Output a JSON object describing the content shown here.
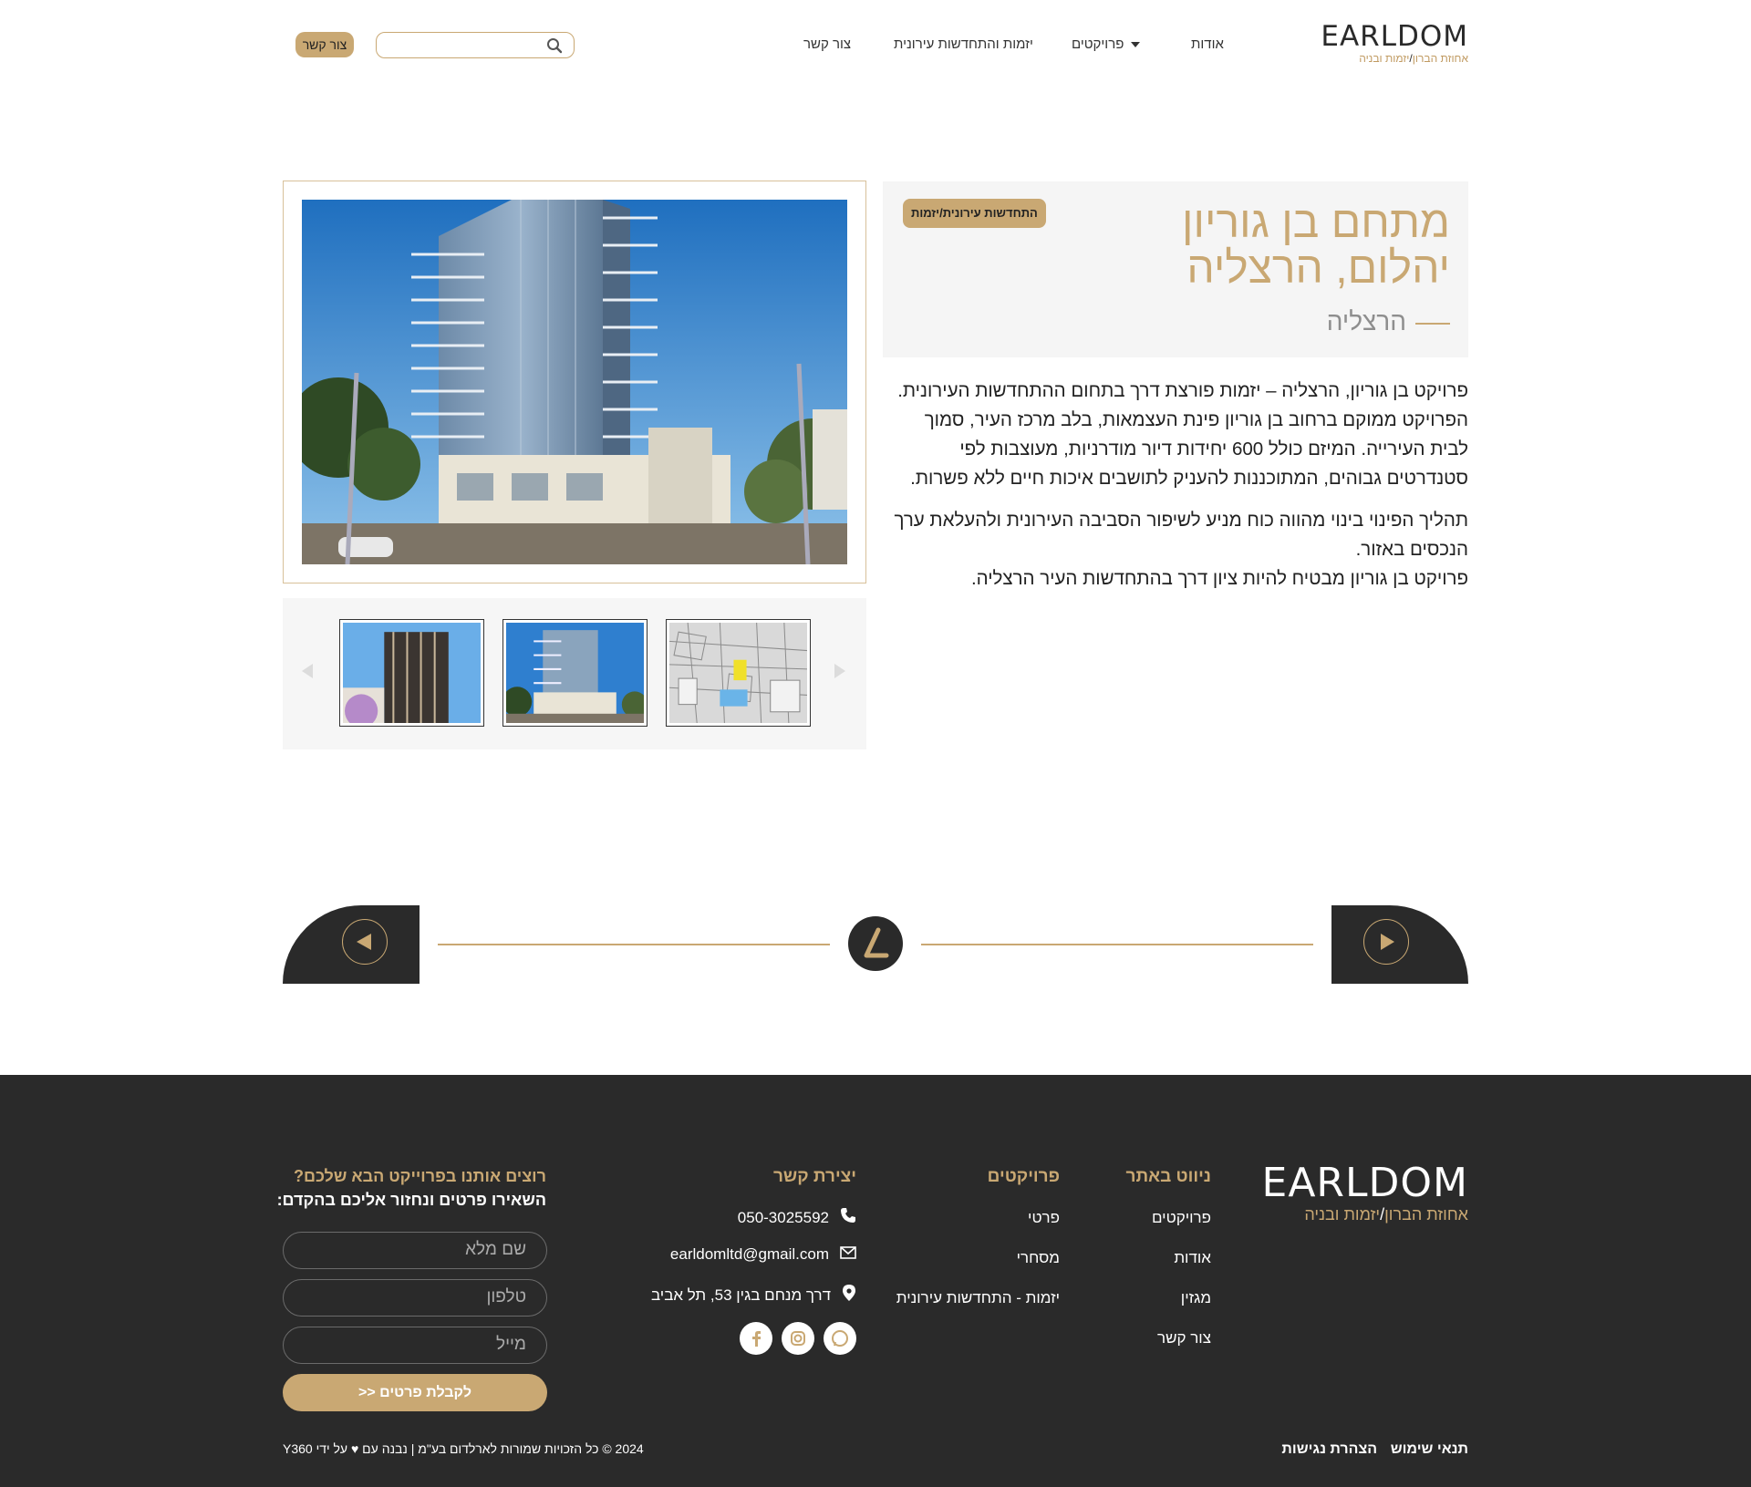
{
  "header": {
    "logo_word": "EARLDOM",
    "logo_sub_1": "אחוזת הברון",
    "logo_sub_sep": "/",
    "logo_sub_2": "יזמות ובניה",
    "nav": [
      "אודות",
      "פרויקטים",
      "יזמות והתחדשות עירונית",
      "צור קשר"
    ],
    "search_placeholder": "",
    "contact_button": "צור קשר"
  },
  "project": {
    "title": "מתחם בן גוריון יהלום, הרצליה",
    "city": "הרצליה",
    "category": "התחדשות עירונית/יזמות",
    "paragraphs": [
      "פרויקט בן גוריון, הרצליה – יזמות פורצת דרך בתחום ההתחדשות העירונית. הפרויקט ממוקם ברחוב בן גוריון פינת העצמאות, בלב מרכז העיר, סמוך לבית העירייה. המיזם כולל 600 יחידות דיור מודרניות, מעוצבות לפי סטנדרטים גבוהים, המתוכננות להעניק לתושבים איכות חיים ללא פשרות.",
      "תהליך הפינוי בינוי מהווה כוח מניע לשיפור הסביבה העירונית ולהעלאת ערך הנכסים באזור.",
      "פרויקט בן גוריון מבטיח להיות ציון דרך בהתחדשות העיר הרצליה."
    ]
  },
  "footer": {
    "logo_word": "EARLDOM",
    "logo_sub_1": "אחוזת הברון",
    "logo_sub_sep": "/",
    "logo_sub_2": "יזמות ובניה",
    "nav_head": "ניווט באתר",
    "nav_items": [
      "פרויקטים",
      "אודות",
      "מגזין",
      "צור קשר"
    ],
    "projects_head": "פרויקטים",
    "projects_items": [
      "פרטי",
      "מסחרי",
      "יזמות - התחדשות עירונית"
    ],
    "contact_head": "יצירת קשר",
    "phone": "050-3025592",
    "email": "earldomltd@gmail.com",
    "address": "דרך מנחם בגין 53, תל אביב",
    "form_head": "רוצים אותנו בפרוייקט הבא שלכם?",
    "form_sub": "השאירו פרטים ונחזור אליכם בהקדם:",
    "field_name": "שם מלא",
    "field_phone": "טלפון",
    "field_mail": "מייל",
    "submit": "לקבלת פרטים <<",
    "terms": "תנאי שימוש",
    "accessibility": "הצהרת נגישות",
    "copyright": "2024 © כל הזכויות שמורות לארלדום בע\"מ | נבנה עם ♥ על ידי Y360"
  },
  "colors": {
    "gold": "#c9a873",
    "dark": "#2a2a2a",
    "light_panel": "#f5f5f5"
  },
  "icons": [
    "search-icon",
    "chevron-down-icon",
    "arrow-left-icon",
    "arrow-right-icon",
    "phone-icon",
    "mail-icon",
    "location-pin-icon",
    "facebook-icon",
    "instagram-icon",
    "whatsapp-icon",
    "earldom-mark-icon"
  ]
}
